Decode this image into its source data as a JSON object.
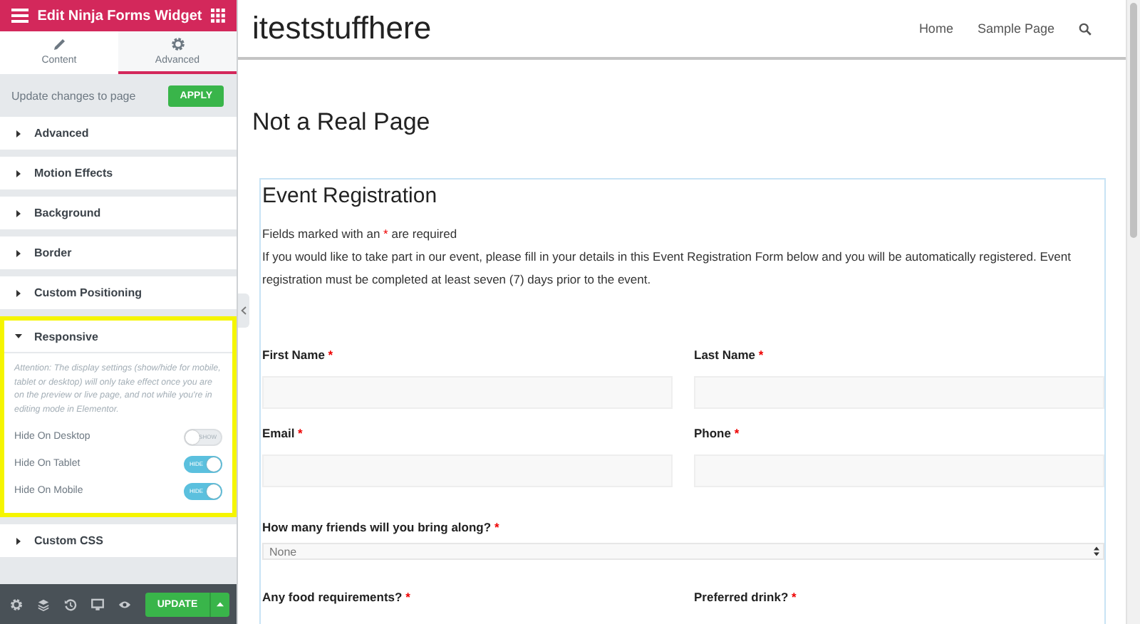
{
  "editor": {
    "title": "Edit Ninja Forms Widget",
    "tabs": [
      {
        "label": "Content",
        "kind": "pencil",
        "selected": false
      },
      {
        "label": "Advanced",
        "kind": "gear",
        "selected": true
      }
    ],
    "update_bar": {
      "text": "Update changes to page",
      "button": "APPLY"
    },
    "sections": [
      {
        "label": "Advanced",
        "expanded": false,
        "highlighted": false
      },
      {
        "label": "Motion Effects",
        "expanded": false,
        "highlighted": false
      },
      {
        "label": "Background",
        "expanded": false,
        "highlighted": false
      },
      {
        "label": "Border",
        "expanded": false,
        "highlighted": false
      },
      {
        "label": "Custom Positioning",
        "expanded": false,
        "highlighted": false
      },
      {
        "label": "Responsive",
        "expanded": true,
        "highlighted": true,
        "note": "Attention: The display settings (show/hide for mobile, tablet or desktop) will only take effect once you are on the preview or live page, and not while you're in editing mode in Elementor.",
        "toggles": [
          {
            "label": "Hide On Desktop",
            "on": false,
            "text": "SHOW"
          },
          {
            "label": "Hide On Tablet",
            "on": true,
            "text": "HIDE"
          },
          {
            "label": "Hide On Mobile",
            "on": true,
            "text": "HIDE"
          }
        ]
      },
      {
        "label": "Custom CSS",
        "expanded": false,
        "highlighted": false
      }
    ],
    "footer": {
      "tools": [
        {
          "kind": "gear"
        },
        {
          "kind": "layers"
        },
        {
          "kind": "history"
        },
        {
          "kind": "monitor"
        },
        {
          "kind": "eye"
        }
      ],
      "button": "UPDATE"
    }
  },
  "site": {
    "title": "iteststuffhere",
    "nav": [
      {
        "label": "Home"
      },
      {
        "label": "Sample Page"
      }
    ],
    "page_title": "Not a Real Page",
    "form": {
      "title": "Event Registration",
      "required_note": {
        "before": "Fields marked with an",
        "mark": "*",
        "after": "are required"
      },
      "intro": "If you would like to take part in our event, please fill in your details in this Event Registration Form below and you will be automatically registered. Event registration must be completed at least seven (7) days prior to the event.",
      "rows": [
        {
          "fields": [
            {
              "label": "First Name",
              "mark": "*",
              "kind": "text"
            },
            {
              "label": "Last Name",
              "mark": "*",
              "kind": "text"
            }
          ]
        },
        {
          "fields": [
            {
              "label": "Email",
              "mark": "*",
              "kind": "text"
            },
            {
              "label": "Phone",
              "mark": "*",
              "kind": "text"
            }
          ]
        },
        {
          "fields": [
            {
              "label": "How many friends will you bring along?",
              "mark": "*",
              "kind": "select",
              "value": "None"
            }
          ]
        },
        {
          "fields": [
            {
              "label": "Any food requirements?",
              "mark": "*",
              "kind": "label"
            },
            {
              "label": "Preferred drink?",
              "mark": "*",
              "kind": "label"
            }
          ]
        }
      ]
    }
  }
}
